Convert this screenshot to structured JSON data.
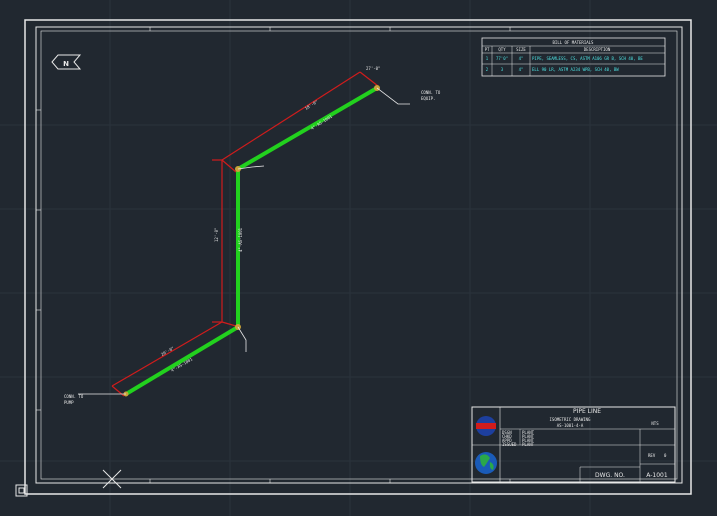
{
  "drawing": {
    "north_label": "N",
    "bom": {
      "title": "BILL OF MATERIALS",
      "headers": [
        "PT",
        "QTY",
        "SIZE",
        "DESCRIPTION"
      ],
      "rows": [
        [
          "1",
          "77'0\"",
          "4\"",
          "PIPE, SEAMLESS, CS, ASTM A106 GR B, SCH 40, BE"
        ],
        [
          "2",
          "3",
          "4\"",
          "ELL 90 LR, ASTM A234 WPB, SCH 40, BW"
        ]
      ]
    },
    "title_block": {
      "project": "PIPE LINE",
      "subtitle": "ISOMETRIC DRAWING",
      "line_id": "AS-1001-4-A",
      "scale": "NTS",
      "rows": [
        [
          "DSGN",
          "PLANT"
        ],
        [
          "CHKD",
          "PLANT"
        ],
        [
          "APPD",
          "PLANT"
        ],
        [
          "ISSUED",
          "PLANT"
        ]
      ],
      "drawing_label": "DWG. NO.",
      "drawing_number": "A-1001",
      "sheet_label": "REV",
      "sheet_value": "0"
    },
    "dimensions": [
      "18'-0\"",
      "12'-0\"",
      "20'-0\"",
      "27'-0\""
    ],
    "pipe_labels": [
      "4\"-AS-1001",
      "4\"-AS-1001",
      "4\"-AS-1001"
    ],
    "callouts": [
      "CONN. TO",
      "EQUIP.",
      "CONN. TO",
      "PUMP"
    ],
    "colors": {
      "background": "#212830",
      "border": "#e8e8e8",
      "pipe": "#22d11e",
      "dimension": "#d01c1c",
      "accent": "#4de0e0"
    }
  }
}
